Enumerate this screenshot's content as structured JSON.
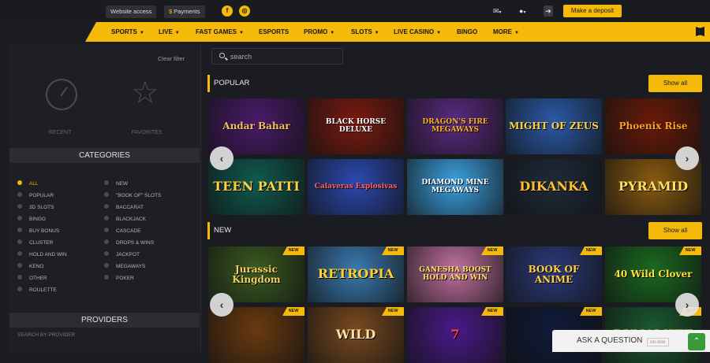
{
  "topbar": {
    "website_access": "Website access",
    "payments": "Payments",
    "payments_icon": "$",
    "deposit": "Make a deposit",
    "icons": [
      "facebook-icon",
      "instagram-icon",
      "mail-icon",
      "user-icon",
      "logout-icon"
    ]
  },
  "nav": {
    "items": [
      {
        "label": "SPORTS",
        "dropdown": true
      },
      {
        "label": "LIVE",
        "dropdown": true
      },
      {
        "label": "FAST GAMES",
        "dropdown": true
      },
      {
        "label": "ESPORTS",
        "dropdown": false
      },
      {
        "label": "PROMO",
        "dropdown": true
      },
      {
        "label": "SLOTS",
        "dropdown": true
      },
      {
        "label": "LIVE CASINO",
        "dropdown": true
      },
      {
        "label": "BINGO",
        "dropdown": false
      },
      {
        "label": "MORE",
        "dropdown": true
      }
    ]
  },
  "sidebar": {
    "clear_filter": "Clear filter",
    "recent": "RECENT",
    "favorites": "FAVORITES",
    "categories_title": "CATEGORIES",
    "categories_left": [
      "ALL",
      "POPULAR",
      "3D SLOTS",
      "BINGO",
      "BUY BONUS",
      "CLUSTER",
      "HOLD AND WIN",
      "KENO",
      "OTHER",
      "ROULETTE"
    ],
    "categories_right": [
      "NEW",
      "\"BOOK OF\" SLOTS",
      "BACCARAT",
      "BLACKJACK",
      "CASCADE",
      "DROPS & WINS",
      "JACKPOT",
      "MEGAWAYS",
      "POKER"
    ],
    "active_category": "ALL",
    "providers_title": "PROVIDERS",
    "search_provider": "SEARCH BY PROVIDER"
  },
  "search": {
    "placeholder": "search"
  },
  "popular": {
    "title": "POPULAR",
    "show_all": "Show all",
    "games": [
      {
        "name": "Andar Bahar",
        "bg": "#4a1a6a",
        "fg": "#f0c060"
      },
      {
        "name": "BLACK HORSE DELUXE",
        "bg": "#7a1a10",
        "fg": "#ffffff"
      },
      {
        "name": "DRAGON'S FIRE MEGAWAYS",
        "bg": "#5a2a80",
        "fg": "#ffb020"
      },
      {
        "name": "MIGHT OF ZEUS",
        "bg": "#2a5aa8",
        "fg": "#ffd040"
      },
      {
        "name": "Phoenix Rise",
        "bg": "#6a1a08",
        "fg": "#ffa020"
      },
      {
        "name": "TEEN PATTI",
        "bg": "#0f5a50",
        "fg": "#ffd040"
      },
      {
        "name": "Calaveras Explosivas",
        "bg": "#2a4ab0",
        "fg": "#ff6060"
      },
      {
        "name": "DIAMOND MINE MEGAWAYS",
        "bg": "#3aa0e0",
        "fg": "#ffffff"
      },
      {
        "name": "DIKANKA",
        "bg": "#1e2a3a",
        "fg": "#ffc030"
      },
      {
        "name": "PYRAMID",
        "bg": "#8a5a10",
        "fg": "#ffe060"
      }
    ]
  },
  "new": {
    "title": "NEW",
    "show_all": "Show all",
    "badge": "NEW",
    "games": [
      {
        "name": "Jurassic Kingdom",
        "bg": "#3a5a20",
        "fg": "#f0d060"
      },
      {
        "name": "RETROPIA",
        "bg": "#3a7ab0",
        "fg": "#ffd030"
      },
      {
        "name": "GANESHA BOOST HOLD AND WIN",
        "bg": "#c070a0",
        "fg": "#ffe060"
      },
      {
        "name": "BOOK OF ANIME",
        "bg": "#2a3a7a",
        "fg": "#ffd040"
      },
      {
        "name": "40 Wild Clover",
        "bg": "#1a6a20",
        "fg": "#ffe040"
      },
      {
        "name": "",
        "bg": "#6a3a10",
        "fg": "#ffd040"
      },
      {
        "name": "WILD",
        "bg": "#7a4a20",
        "fg": "#ffe0a0"
      },
      {
        "name": "7",
        "bg": "#4a1a8a",
        "fg": "#ff4040"
      },
      {
        "name": "",
        "bg": "#101a3a",
        "fg": "#40a0ff"
      },
      {
        "name": "DYNAMITE",
        "bg": "#1a5a30",
        "fg": "#ffd040"
      }
    ]
  },
  "chat": {
    "label": "ASK A QUESTION",
    "status": "on-line"
  }
}
